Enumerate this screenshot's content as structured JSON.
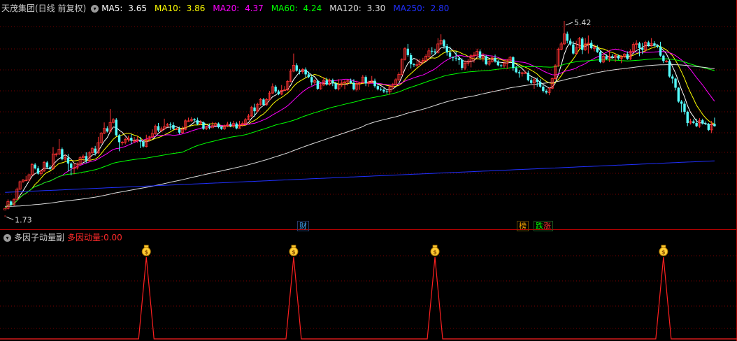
{
  "main": {
    "title": "天茂集团(日线 前复权)",
    "ma": [
      {
        "label": "MA5:",
        "value": "3.65",
        "color": "#ffffff"
      },
      {
        "label": "MA10:",
        "value": "3.86",
        "color": "#ffff00"
      },
      {
        "label": "MA20:",
        "value": "4.37",
        "color": "#ff00ff"
      },
      {
        "label": "MA60:",
        "value": "4.24",
        "color": "#00ff00"
      },
      {
        "label": "MA120:",
        "value": "3.30",
        "color": "#dddddd"
      },
      {
        "label": "MA250:",
        "value": "2.80",
        "color": "#2030ff"
      }
    ],
    "high_label": "5.42",
    "low_label": "1.73",
    "marks": [
      {
        "text": "财",
        "color": "#44aaff"
      },
      {
        "text": "榜",
        "color": "#ffaa00"
      },
      {
        "text": "跌",
        "color": "#00ff00"
      },
      {
        "text": "涨",
        "color": "#ff3333"
      }
    ]
  },
  "sub": {
    "title": "多因子动量副",
    "value_label": "多因动量:",
    "value": "0.00",
    "signal_icon": "money-bag-icon",
    "signals_at_bar": [
      47,
      96,
      143,
      219
    ]
  },
  "colors": {
    "up": "#ff3232",
    "down": "#54ffff",
    "grid": "#7a0000"
  },
  "chart_data": {
    "type": "candlestick",
    "price_range": [
      1.73,
      5.42
    ],
    "candles": [
      [
        1.88,
        1.91,
        1.78,
        1.75
      ],
      [
        1.91,
        2.04,
        2.08,
        1.89
      ],
      [
        2.04,
        1.98,
        2.06,
        1.96
      ],
      [
        1.98,
        2.08,
        2.1,
        1.96
      ],
      [
        2.08,
        2.27,
        2.3,
        2.06
      ],
      [
        2.27,
        2.41,
        2.43,
        2.25
      ],
      [
        2.41,
        2.44,
        2.46,
        2.39
      ],
      [
        2.44,
        2.44,
        2.52,
        2.42
      ],
      [
        2.44,
        2.54,
        2.56,
        2.4
      ],
      [
        2.54,
        2.73,
        2.76,
        2.52
      ],
      [
        2.73,
        2.66,
        2.76,
        2.64
      ],
      [
        2.66,
        2.56,
        2.7,
        2.54
      ],
      [
        2.56,
        2.61,
        2.63,
        2.52
      ],
      [
        2.61,
        2.77,
        2.8,
        2.59
      ],
      [
        2.77,
        2.68,
        2.8,
        2.66
      ],
      [
        2.68,
        2.65,
        2.72,
        2.62
      ],
      [
        2.65,
        2.93,
        3.06,
        2.63
      ],
      [
        2.93,
        2.93,
        2.95,
        2.88
      ],
      [
        2.93,
        3.02,
        3.21,
        2.91
      ],
      [
        3.02,
        2.83,
        3.05,
        2.81
      ],
      [
        2.83,
        2.86,
        2.92,
        2.8
      ],
      [
        2.86,
        2.75,
        2.93,
        2.6
      ],
      [
        2.75,
        2.67,
        2.77,
        2.53
      ],
      [
        2.67,
        2.67,
        2.76,
        2.55
      ],
      [
        2.67,
        2.74,
        2.77,
        2.64
      ],
      [
        2.74,
        2.86,
        2.89,
        2.72
      ],
      [
        2.86,
        2.89,
        2.92,
        2.78
      ],
      [
        2.89,
        2.81,
        2.96,
        2.76
      ],
      [
        2.81,
        2.95,
        2.98,
        2.79
      ],
      [
        2.95,
        3.03,
        3.06,
        2.93
      ],
      [
        3.03,
        2.95,
        3.08,
        2.9
      ],
      [
        2.95,
        3.14,
        3.25,
        2.93
      ],
      [
        3.14,
        3.32,
        3.34,
        3.12
      ],
      [
        3.32,
        3.41,
        3.52,
        3.3
      ],
      [
        3.41,
        3.35,
        3.45,
        3.33
      ],
      [
        3.35,
        3.52,
        3.77,
        3.32
      ],
      [
        3.52,
        3.57,
        3.6,
        3.5
      ],
      [
        3.57,
        3.28,
        3.6,
        3.26
      ],
      [
        3.28,
        3.15,
        3.3,
        2.98
      ],
      [
        3.15,
        3.15,
        3.17,
        3.09
      ],
      [
        3.15,
        3.2,
        3.24,
        3.11
      ],
      [
        3.2,
        3.23,
        3.27,
        3.16
      ],
      [
        3.23,
        3.18,
        3.3,
        3.11
      ],
      [
        3.18,
        3.18,
        3.25,
        3.13
      ],
      [
        3.18,
        3.19,
        3.26,
        3.14
      ],
      [
        3.19,
        3.16,
        3.25,
        3.04
      ],
      [
        3.16,
        3.07,
        3.19,
        3.05
      ],
      [
        3.07,
        3.2,
        3.29,
        3.05
      ],
      [
        3.2,
        3.25,
        3.27,
        3.16
      ],
      [
        3.25,
        3.31,
        3.39,
        3.22
      ],
      [
        3.31,
        3.45,
        3.48,
        3.29
      ],
      [
        3.45,
        3.37,
        3.51,
        3.34
      ],
      [
        3.37,
        3.4,
        3.44,
        3.34
      ],
      [
        3.4,
        3.44,
        3.59,
        3.38
      ],
      [
        3.44,
        3.48,
        3.51,
        3.45
      ],
      [
        3.48,
        3.47,
        3.52,
        3.38
      ],
      [
        3.47,
        3.4,
        3.52,
        3.38
      ],
      [
        3.4,
        3.4,
        3.42,
        3.38
      ],
      [
        3.4,
        3.33,
        3.44,
        3.3
      ],
      [
        3.33,
        3.39,
        3.45,
        3.31
      ],
      [
        3.39,
        3.55,
        3.58,
        3.37
      ],
      [
        3.55,
        3.55,
        3.61,
        3.53
      ],
      [
        3.55,
        3.58,
        3.62,
        3.53
      ],
      [
        3.58,
        3.56,
        3.6,
        3.54
      ],
      [
        3.56,
        3.49,
        3.61,
        3.47
      ],
      [
        3.49,
        3.52,
        3.56,
        3.47
      ],
      [
        3.52,
        3.4,
        3.54,
        3.38
      ],
      [
        3.4,
        3.44,
        3.46,
        3.38
      ],
      [
        3.44,
        3.42,
        3.5,
        3.39
      ],
      [
        3.42,
        3.46,
        3.53,
        3.44
      ],
      [
        3.46,
        3.5,
        3.52,
        3.48
      ],
      [
        3.5,
        3.43,
        3.52,
        3.41
      ],
      [
        3.43,
        3.4,
        3.45,
        3.38
      ],
      [
        3.4,
        3.46,
        3.48,
        3.38
      ],
      [
        3.46,
        3.49,
        3.53,
        3.43
      ],
      [
        3.49,
        3.46,
        3.53,
        3.43
      ],
      [
        3.46,
        3.5,
        3.55,
        3.42
      ],
      [
        3.5,
        3.41,
        3.53,
        3.39
      ],
      [
        3.41,
        3.47,
        3.55,
        3.41
      ],
      [
        3.47,
        3.5,
        3.54,
        3.44
      ],
      [
        3.5,
        3.57,
        3.6,
        3.46
      ],
      [
        3.57,
        3.64,
        3.68,
        3.56
      ],
      [
        3.64,
        3.8,
        3.83,
        3.62
      ],
      [
        3.8,
        3.73,
        3.87,
        3.63
      ],
      [
        3.73,
        3.86,
        3.89,
        3.71
      ],
      [
        3.86,
        3.95,
        3.98,
        3.83
      ],
      [
        3.95,
        3.85,
        3.98,
        3.83
      ],
      [
        3.85,
        3.95,
        3.98,
        3.83
      ],
      [
        3.95,
        4.07,
        4.11,
        3.93
      ],
      [
        4.07,
        4.19,
        4.25,
        4.05
      ],
      [
        4.19,
        4.1,
        4.22,
        4.07
      ],
      [
        4.1,
        4.05,
        4.13,
        4.03
      ],
      [
        4.05,
        4.12,
        4.22,
        4.03
      ],
      [
        4.12,
        4.13,
        4.2,
        4.11
      ],
      [
        4.13,
        4.29,
        4.31,
        4.11
      ],
      [
        4.29,
        4.48,
        4.52,
        4.27
      ],
      [
        4.48,
        4.59,
        4.81,
        4.46
      ],
      [
        4.59,
        4.49,
        4.63,
        4.47
      ],
      [
        4.49,
        4.47,
        4.52,
        4.42
      ],
      [
        4.47,
        4.51,
        4.54,
        4.43
      ],
      [
        4.51,
        4.42,
        4.55,
        4.36
      ],
      [
        4.42,
        4.37,
        4.47,
        4.35
      ],
      [
        4.37,
        4.27,
        4.41,
        4.21
      ],
      [
        4.27,
        4.3,
        4.33,
        4.22
      ],
      [
        4.3,
        4.15,
        4.32,
        4.13
      ],
      [
        4.15,
        4.22,
        4.26,
        4.13
      ],
      [
        4.22,
        4.31,
        4.37,
        4.2
      ],
      [
        4.31,
        4.23,
        4.36,
        4.21
      ],
      [
        4.23,
        4.31,
        4.34,
        4.21
      ],
      [
        4.31,
        4.25,
        4.34,
        4.2
      ],
      [
        4.25,
        4.15,
        4.28,
        4.13
      ],
      [
        4.15,
        4.22,
        4.33,
        4.12
      ],
      [
        4.22,
        4.26,
        4.31,
        4.18
      ],
      [
        4.26,
        4.28,
        4.31,
        4.14
      ],
      [
        4.28,
        4.3,
        4.32,
        4.21
      ],
      [
        4.3,
        4.26,
        4.34,
        4.24
      ],
      [
        4.26,
        4.14,
        4.33,
        4.12
      ],
      [
        4.14,
        4.25,
        4.3,
        4.1
      ],
      [
        4.25,
        4.27,
        4.28,
        4.13
      ],
      [
        4.27,
        4.37,
        4.41,
        4.25
      ],
      [
        4.37,
        4.25,
        4.4,
        4.2
      ],
      [
        4.25,
        4.28,
        4.3,
        4.19
      ],
      [
        4.28,
        4.3,
        4.39,
        4.26
      ],
      [
        4.3,
        4.2,
        4.34,
        4.17
      ],
      [
        4.2,
        4.14,
        4.26,
        4.12
      ],
      [
        4.14,
        4.13,
        4.18,
        4.11
      ],
      [
        4.13,
        4.1,
        4.16,
        4.07
      ],
      [
        4.1,
        4.09,
        4.15,
        4.06
      ],
      [
        4.09,
        4.19,
        4.21,
        4.04
      ],
      [
        4.19,
        4.23,
        4.26,
        4.14
      ],
      [
        4.23,
        4.32,
        4.35,
        4.21
      ],
      [
        4.32,
        4.42,
        4.46,
        4.29
      ],
      [
        4.42,
        4.7,
        4.72,
        4.4
      ],
      [
        4.7,
        4.9,
        4.93,
        4.68
      ],
      [
        4.9,
        4.78,
        4.99,
        4.75
      ],
      [
        4.78,
        4.61,
        4.82,
        4.53
      ],
      [
        4.61,
        4.6,
        4.63,
        4.56
      ],
      [
        4.6,
        4.6,
        4.71,
        4.55
      ],
      [
        4.6,
        4.65,
        4.71,
        4.58
      ],
      [
        4.65,
        4.68,
        4.73,
        4.62
      ],
      [
        4.68,
        4.76,
        4.8,
        4.66
      ],
      [
        4.76,
        4.86,
        4.91,
        4.68
      ],
      [
        4.86,
        4.85,
        4.93,
        4.79
      ],
      [
        4.85,
        4.83,
        4.9,
        4.79
      ],
      [
        4.83,
        4.99,
        5.1,
        4.81
      ],
      [
        4.99,
        5.06,
        5.17,
        4.96
      ],
      [
        5.06,
        4.95,
        5.08,
        4.9
      ],
      [
        4.95,
        4.83,
        4.99,
        4.77
      ],
      [
        4.83,
        4.75,
        4.94,
        4.71
      ],
      [
        4.75,
        4.73,
        4.75,
        4.67
      ],
      [
        4.73,
        4.72,
        4.85,
        4.67
      ],
      [
        4.72,
        4.69,
        4.76,
        4.6
      ],
      [
        4.69,
        4.54,
        4.72,
        4.5
      ],
      [
        4.54,
        4.63,
        4.68,
        4.5
      ],
      [
        4.63,
        4.67,
        4.71,
        4.58
      ],
      [
        4.67,
        4.77,
        4.8,
        4.55
      ],
      [
        4.77,
        4.78,
        4.84,
        4.64
      ],
      [
        4.78,
        4.85,
        4.9,
        4.73
      ],
      [
        4.85,
        4.73,
        4.89,
        4.69
      ],
      [
        4.73,
        4.76,
        4.82,
        4.66
      ],
      [
        4.76,
        4.61,
        4.78,
        4.59
      ],
      [
        4.61,
        4.66,
        4.7,
        4.58
      ],
      [
        4.66,
        4.73,
        4.77,
        4.64
      ],
      [
        4.73,
        4.66,
        4.79,
        4.64
      ],
      [
        4.66,
        4.59,
        4.69,
        4.57
      ],
      [
        4.59,
        4.58,
        4.62,
        4.55
      ],
      [
        4.58,
        4.63,
        4.69,
        4.54
      ],
      [
        4.63,
        4.69,
        4.71,
        4.52
      ],
      [
        4.69,
        4.74,
        4.76,
        4.67
      ],
      [
        4.74,
        4.54,
        4.76,
        4.49
      ],
      [
        4.54,
        4.46,
        4.58,
        4.44
      ],
      [
        4.46,
        4.44,
        4.5,
        4.36
      ],
      [
        4.44,
        4.45,
        4.47,
        4.38
      ],
      [
        4.45,
        4.45,
        4.49,
        4.43
      ],
      [
        4.45,
        4.31,
        4.49,
        4.29
      ],
      [
        4.31,
        4.26,
        4.36,
        4.24
      ],
      [
        4.26,
        4.32,
        4.35,
        4.15
      ],
      [
        4.32,
        4.28,
        4.36,
        4.19
      ],
      [
        4.28,
        4.19,
        4.33,
        4.17
      ],
      [
        4.19,
        4.11,
        4.22,
        4.08
      ],
      [
        4.11,
        4.08,
        4.14,
        4.05
      ],
      [
        4.08,
        4.16,
        4.18,
        4.03
      ],
      [
        4.16,
        4.34,
        4.36,
        4.14
      ],
      [
        4.34,
        4.58,
        4.61,
        4.32
      ],
      [
        4.58,
        4.89,
        4.92,
        4.56
      ],
      [
        4.89,
        4.99,
        5.03,
        4.87
      ],
      [
        4.99,
        5.18,
        5.42,
        4.97
      ],
      [
        5.18,
        5.05,
        5.22,
        5.0
      ],
      [
        5.05,
        4.98,
        5.09,
        4.96
      ],
      [
        4.98,
        4.81,
        5.04,
        4.79
      ],
      [
        4.81,
        4.92,
        5.05,
        4.79
      ],
      [
        4.92,
        5.09,
        5.12,
        4.9
      ],
      [
        5.09,
        4.88,
        5.12,
        4.8
      ],
      [
        4.88,
        4.99,
        5.1,
        4.86
      ],
      [
        4.99,
        5.01,
        5.15,
        4.81
      ],
      [
        5.01,
        4.91,
        5.06,
        4.89
      ],
      [
        4.91,
        4.92,
        4.98,
        4.85
      ],
      [
        4.92,
        4.84,
        4.97,
        4.82
      ],
      [
        4.84,
        4.65,
        4.87,
        4.63
      ],
      [
        4.65,
        4.76,
        4.82,
        4.63
      ],
      [
        4.76,
        4.71,
        4.8,
        4.69
      ],
      [
        4.71,
        4.76,
        4.87,
        4.65
      ],
      [
        4.76,
        4.74,
        4.8,
        4.72
      ],
      [
        4.74,
        4.77,
        4.81,
        4.65
      ],
      [
        4.77,
        4.72,
        4.79,
        4.69
      ],
      [
        4.72,
        4.75,
        4.78,
        4.63
      ],
      [
        4.75,
        4.8,
        4.82,
        4.73
      ],
      [
        4.8,
        4.71,
        4.85,
        4.69
      ],
      [
        4.71,
        4.85,
        4.89,
        4.69
      ],
      [
        4.85,
        4.98,
        5.02,
        4.83
      ],
      [
        4.98,
        5.0,
        5.06,
        4.9
      ],
      [
        5.0,
        4.91,
        5.03,
        4.76
      ],
      [
        4.91,
        4.88,
        5.01,
        4.8
      ],
      [
        4.88,
        5.02,
        5.05,
        4.84
      ],
      [
        5.02,
        4.96,
        5.05,
        4.94
      ],
      [
        4.96,
        5.0,
        5.1,
        4.94
      ],
      [
        5.0,
        4.96,
        5.04,
        4.94
      ],
      [
        4.96,
        4.94,
        4.98,
        4.91
      ],
      [
        4.94,
        4.77,
        5.03,
        4.75
      ],
      [
        4.77,
        4.67,
        4.79,
        4.63
      ],
      [
        4.67,
        4.67,
        4.69,
        4.64
      ],
      [
        4.67,
        4.38,
        4.69,
        4.36
      ],
      [
        4.38,
        4.34,
        4.42,
        4.25
      ],
      [
        4.34,
        4.17,
        4.36,
        4.12
      ],
      [
        4.17,
        3.91,
        4.18,
        3.89
      ],
      [
        3.91,
        3.87,
        3.94,
        3.71
      ],
      [
        3.87,
        3.72,
        3.92,
        3.67
      ],
      [
        3.72,
        3.51,
        3.74,
        3.45
      ],
      [
        3.51,
        3.54,
        3.59,
        3.48
      ],
      [
        3.54,
        3.51,
        3.58,
        3.49
      ],
      [
        3.51,
        3.45,
        3.59,
        3.43
      ],
      [
        3.45,
        3.56,
        3.6,
        3.42
      ],
      [
        3.56,
        3.5,
        3.59,
        3.48
      ],
      [
        3.5,
        3.49,
        3.54,
        3.47
      ],
      [
        3.49,
        3.38,
        3.51,
        3.36
      ],
      [
        3.38,
        3.49,
        3.55,
        3.32
      ],
      [
        3.49,
        3.45,
        3.61,
        3.44
      ]
    ]
  }
}
